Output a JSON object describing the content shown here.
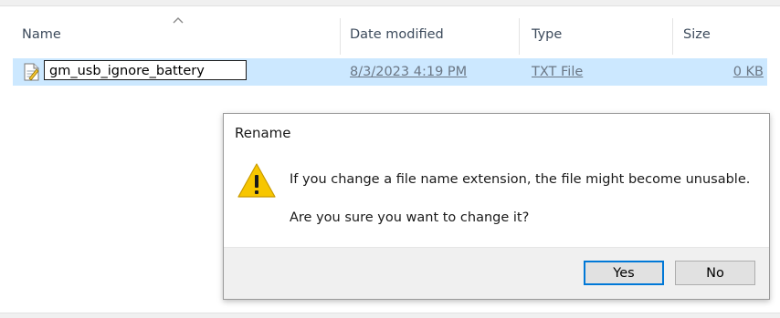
{
  "columns": {
    "name": "Name",
    "date_modified": "Date modified",
    "type": "Type",
    "size": "Size"
  },
  "file_row": {
    "name_edit_value": "gm_usb_ignore_battery",
    "date_modified": "8/3/2023 4:19 PM",
    "type": "TXT File",
    "size": "0 KB"
  },
  "dialog": {
    "title": "Rename",
    "message": "If you change a file name extension, the file might become unusable.",
    "question": "Are you sure you want to change it?",
    "yes_label": "Yes",
    "no_label": "No"
  },
  "colors": {
    "selection": "#cce8ff",
    "accent": "#0078d7",
    "warning": "#f7c600"
  }
}
